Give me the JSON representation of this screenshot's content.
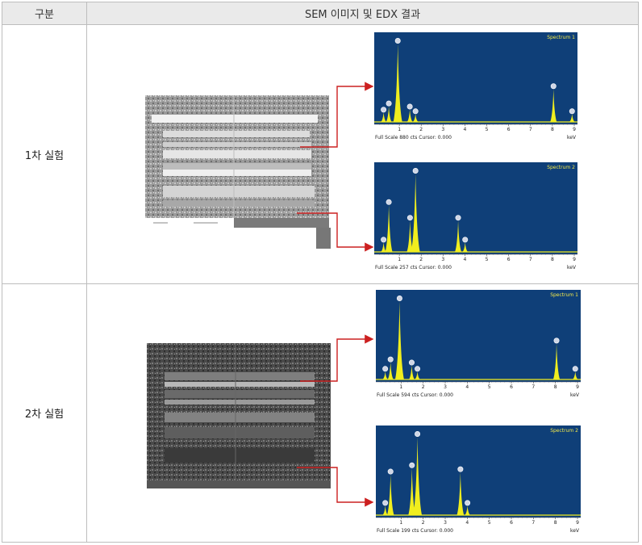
{
  "table": {
    "col1_header": "구분",
    "col2_header": "SEM 이미지 및 EDX 결과",
    "rows": [
      {
        "label": "1차 실험"
      },
      {
        "label": "2차 실험"
      }
    ]
  },
  "colors": {
    "plot_bg": "#0f3f78",
    "peak": "#f0ee1e",
    "arrow": "#cc2020",
    "header_bg": "#eaeaea"
  },
  "spectra": [
    {
      "title": "Spectrum 1",
      "footer_left": "Full Scale 880 cts Cursor: 0.000",
      "footer_right": "keV",
      "x_ticks": [
        "1",
        "2",
        "3",
        "4",
        "5",
        "6",
        "7",
        "8",
        "9"
      ],
      "xlim": [
        0,
        9
      ],
      "peaks": [
        [
          0.28,
          0.12
        ],
        [
          0.52,
          0.2
        ],
        [
          0.93,
          1.0
        ],
        [
          1.48,
          0.16
        ],
        [
          1.74,
          0.1
        ],
        [
          8.05,
          0.42
        ],
        [
          8.9,
          0.1
        ]
      ]
    },
    {
      "title": "Spectrum 2",
      "footer_left": "Full Scale 257 cts Cursor: 0.000",
      "footer_right": "keV",
      "x_ticks": [
        "1",
        "2",
        "3",
        "4",
        "5",
        "6",
        "7",
        "8",
        "9"
      ],
      "xlim": [
        0,
        9
      ],
      "peaks": [
        [
          0.28,
          0.12
        ],
        [
          0.52,
          0.6
        ],
        [
          1.49,
          0.4
        ],
        [
          1.74,
          1.0
        ],
        [
          3.69,
          0.4
        ],
        [
          4.01,
          0.12
        ]
      ]
    },
    {
      "title": "Spectrum 1",
      "footer_left": "Full Scale 594 cts Cursor: 0.000",
      "footer_right": "keV",
      "x_ticks": [
        "1",
        "2",
        "3",
        "4",
        "5",
        "6",
        "7",
        "8",
        "9"
      ],
      "xlim": [
        0,
        9
      ],
      "peaks": [
        [
          0.28,
          0.1
        ],
        [
          0.52,
          0.22
        ],
        [
          0.93,
          1.0
        ],
        [
          1.48,
          0.18
        ],
        [
          1.74,
          0.1
        ],
        [
          8.05,
          0.46
        ],
        [
          8.9,
          0.1
        ]
      ]
    },
    {
      "title": "Spectrum 2",
      "footer_left": "Full Scale 199 cts Cursor: 0.000",
      "footer_right": "keV",
      "x_ticks": [
        "1",
        "2",
        "3",
        "4",
        "5",
        "6",
        "7",
        "8",
        "9"
      ],
      "xlim": [
        0,
        9
      ],
      "peaks": [
        [
          0.28,
          0.12
        ],
        [
          0.52,
          0.52
        ],
        [
          1.49,
          0.6
        ],
        [
          1.74,
          1.0
        ],
        [
          3.69,
          0.55
        ],
        [
          4.01,
          0.12
        ]
      ]
    }
  ]
}
